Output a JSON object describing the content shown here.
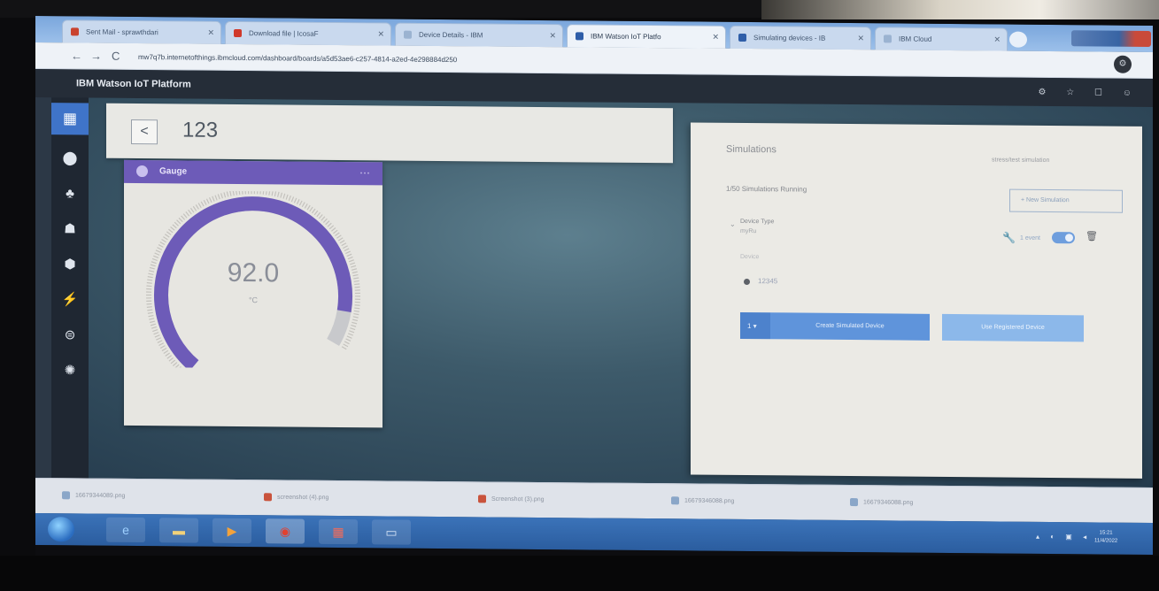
{
  "browser": {
    "tabs": [
      {
        "label": "Sent Mail - sprawthdari",
        "favicon_color": "#c9432f"
      },
      {
        "label": "Download file | IcosaF",
        "favicon_color": "#d0392b"
      },
      {
        "label": "Device Details - IBM",
        "favicon_color": "#9bb3d1"
      },
      {
        "label": "IBM Watson IoT Platfo",
        "favicon_color": "#2f5ea8"
      },
      {
        "label": "Simulating devices - IB",
        "favicon_color": "#2f5ea8"
      },
      {
        "label": "IBM Cloud",
        "favicon_color": "#9bb3d1"
      }
    ],
    "url": "mw7q7b.internetofthings.ibmcloud.com/dashboard/boards/a5d53ae6-c257-4814-a2ed-4e298884d250",
    "back_symbol": "←",
    "forward_symbol": "→",
    "reload_symbol": "C"
  },
  "app": {
    "brand": "IBM Watson IoT Platform",
    "header_icons": "⚙ ☆ ☐ ☺"
  },
  "sidebar": {
    "items": [
      "apps-icon",
      "boards-icon",
      "devices-icon",
      "members-icon",
      "apps-integration-icon",
      "rules-icon",
      "security-icon",
      "settings-icon"
    ]
  },
  "board": {
    "back_symbol": "<",
    "title": "123"
  },
  "gauge": {
    "label": "Gauge",
    "menu_symbol": "⋯",
    "value_text": "92.0",
    "unit": "°C",
    "level_fraction": 0.92,
    "accent_color": "#6d5bb8"
  },
  "simulations": {
    "title": "Simulations",
    "status_select": "stress/test simulation",
    "running_text": "1/50 Simulations Running",
    "new_simulation": "+ New Simulation",
    "device_type_label": "Device Type",
    "device_type_value": "myRu",
    "faint_label": "Device",
    "device_id": "12345",
    "events_label": "1 event",
    "toggle_on": true,
    "count_select": "1 ▾",
    "create_button": "Create Simulated Device",
    "use_registered_button": "Use Registered Device"
  },
  "downloads": [
    "16679344089.png",
    "screenshot (4).png",
    "Screenshot (3).png",
    "16679346088.png",
    "16679346088.png"
  ],
  "taskbar": {
    "time": "15:21",
    "date": "11/4/2022"
  }
}
